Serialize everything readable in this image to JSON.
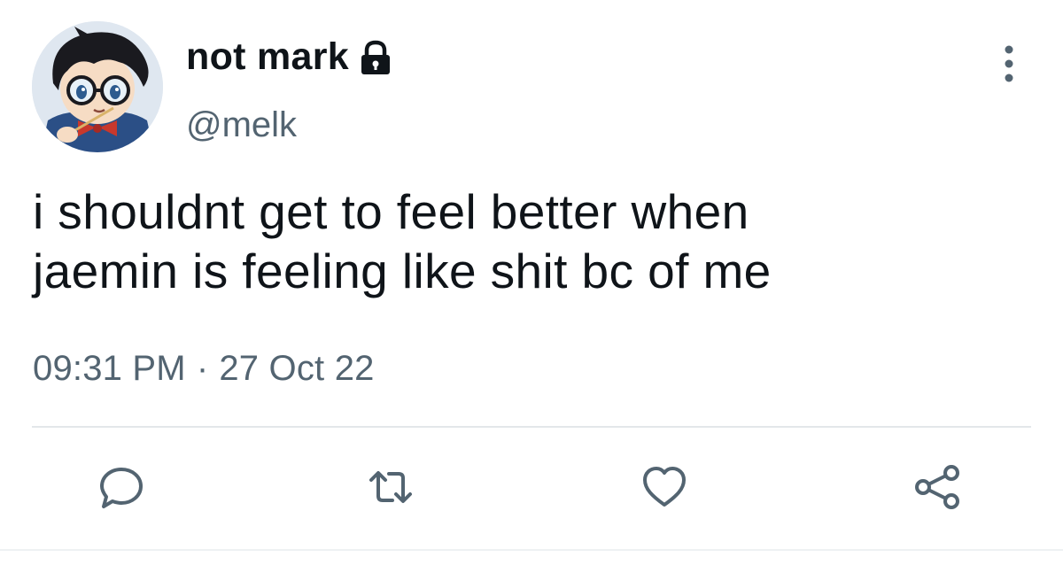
{
  "tweet": {
    "display_name": "not mark",
    "handle": "@melk",
    "text": "i shouldnt get to feel better when\njaemin is feeling like shit bc of me",
    "time": "09:31 PM",
    "separator": "·",
    "date": "27 Oct 22"
  },
  "icons": {
    "lock": "lock-icon",
    "more": "more-vertical-icon",
    "reply": "reply-icon",
    "retweet": "retweet-icon",
    "like": "heart-icon",
    "share": "share-icon"
  },
  "colors": {
    "text_primary": "#0f1419",
    "text_secondary": "#536471",
    "divider": "#e3e7ea"
  }
}
